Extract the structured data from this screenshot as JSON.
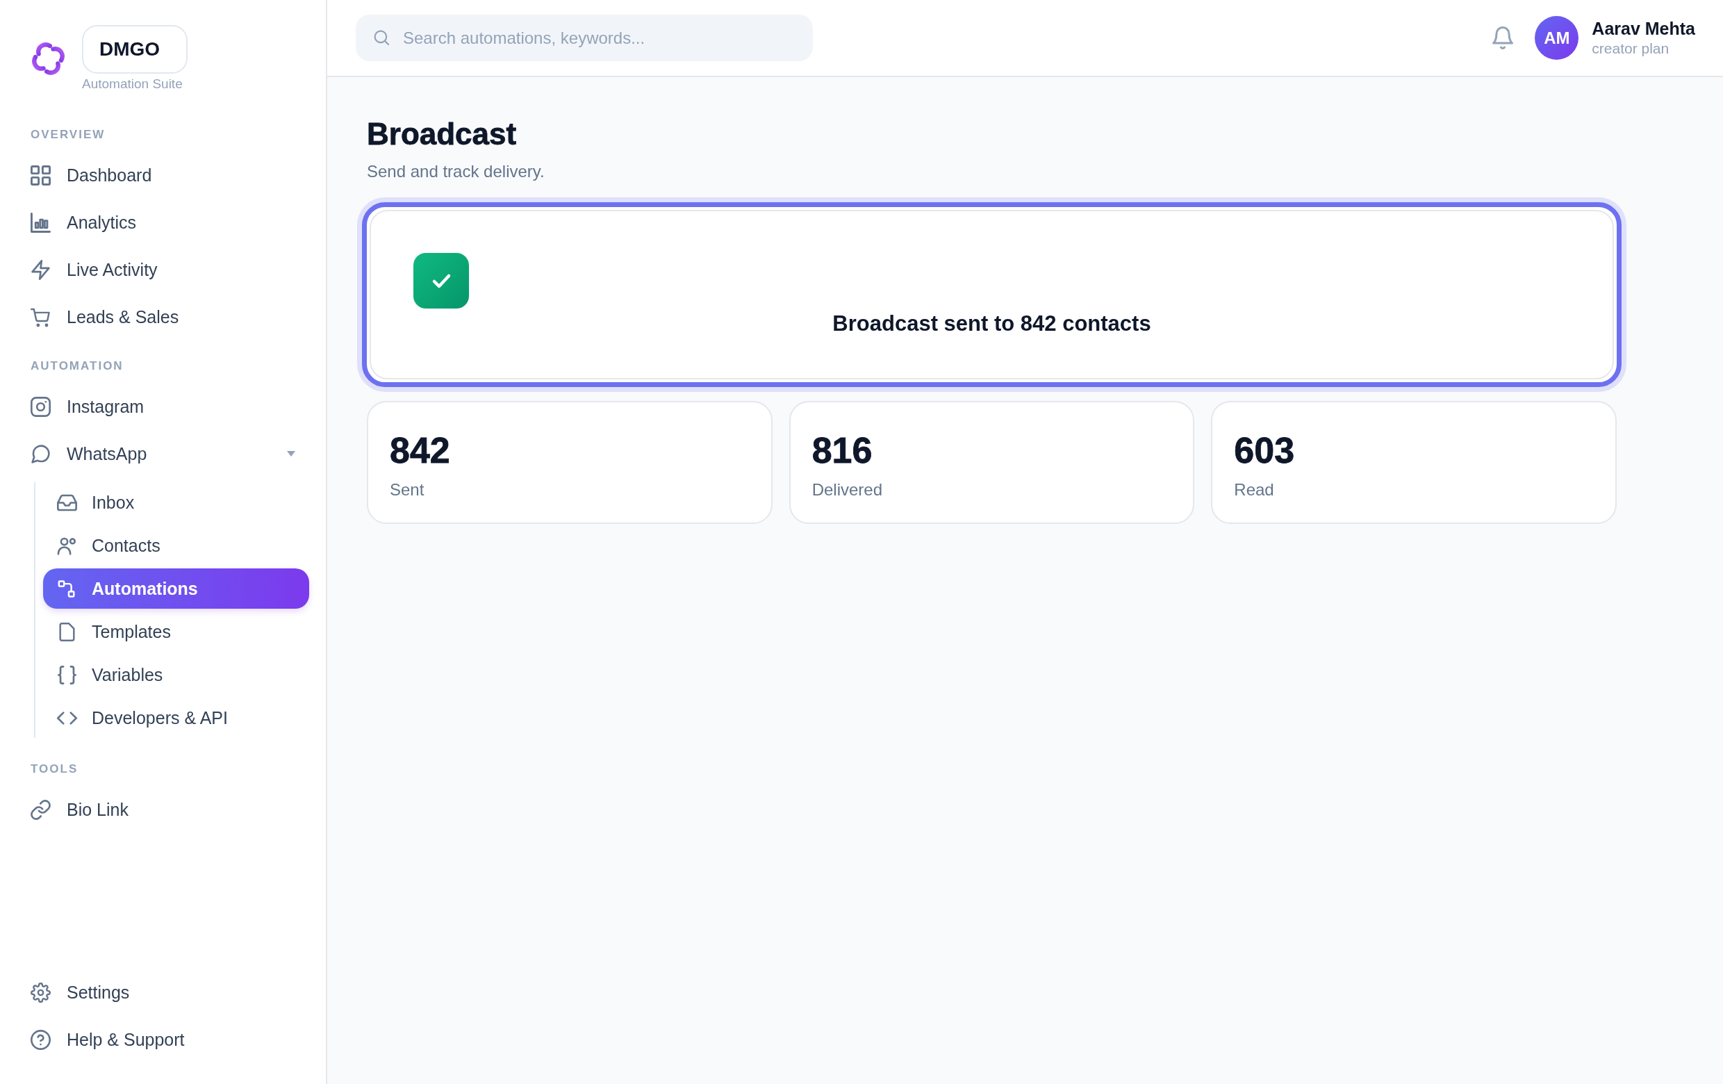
{
  "sidebar": {
    "brand": {
      "name": "DMGO",
      "tagline": "Automation Suite"
    },
    "sections": [
      {
        "heading": "OVERVIEW",
        "items": [
          {
            "label": "Dashboard",
            "selected": false
          },
          {
            "label": "Analytics",
            "selected": false
          },
          {
            "label": "Live Activity",
            "selected": false
          },
          {
            "label": "Leads & Sales",
            "selected": false
          }
        ]
      },
      {
        "heading": "AUTOMATION",
        "items": [
          {
            "label": "Instagram",
            "selected": false
          },
          {
            "label": "WhatsApp",
            "selected": false,
            "expanded": true,
            "children": [
              {
                "label": "Inbox",
                "selected": false
              },
              {
                "label": "Contacts",
                "selected": false
              },
              {
                "label": "Automations",
                "selected": true
              },
              {
                "label": "Templates",
                "selected": false
              },
              {
                "label": "Variables",
                "selected": false
              },
              {
                "label": "Developers & API",
                "selected": false
              }
            ]
          }
        ]
      },
      {
        "heading": "TOOLS",
        "items": [
          {
            "label": "Bio Link",
            "selected": false
          }
        ]
      }
    ],
    "footer_items": [
      {
        "label": "Settings",
        "selected": false
      },
      {
        "label": "Help & Support",
        "selected": false
      }
    ]
  },
  "top_bar": {
    "search": {
      "placeholder": "Search automations, keywords..."
    },
    "user": {
      "initials": "AM",
      "name": "Aarav Mehta",
      "plan": "creator plan"
    }
  },
  "page": {
    "title": "Broadcast",
    "subtitle": "Send and track delivery."
  },
  "result": {
    "kind": "success",
    "message": "Broadcast sent to 842 contacts"
  },
  "stats": [
    {
      "value": "842",
      "label": "Sent"
    },
    {
      "value": "816",
      "label": "Delivered"
    },
    {
      "value": "603",
      "label": "Read"
    }
  ]
}
